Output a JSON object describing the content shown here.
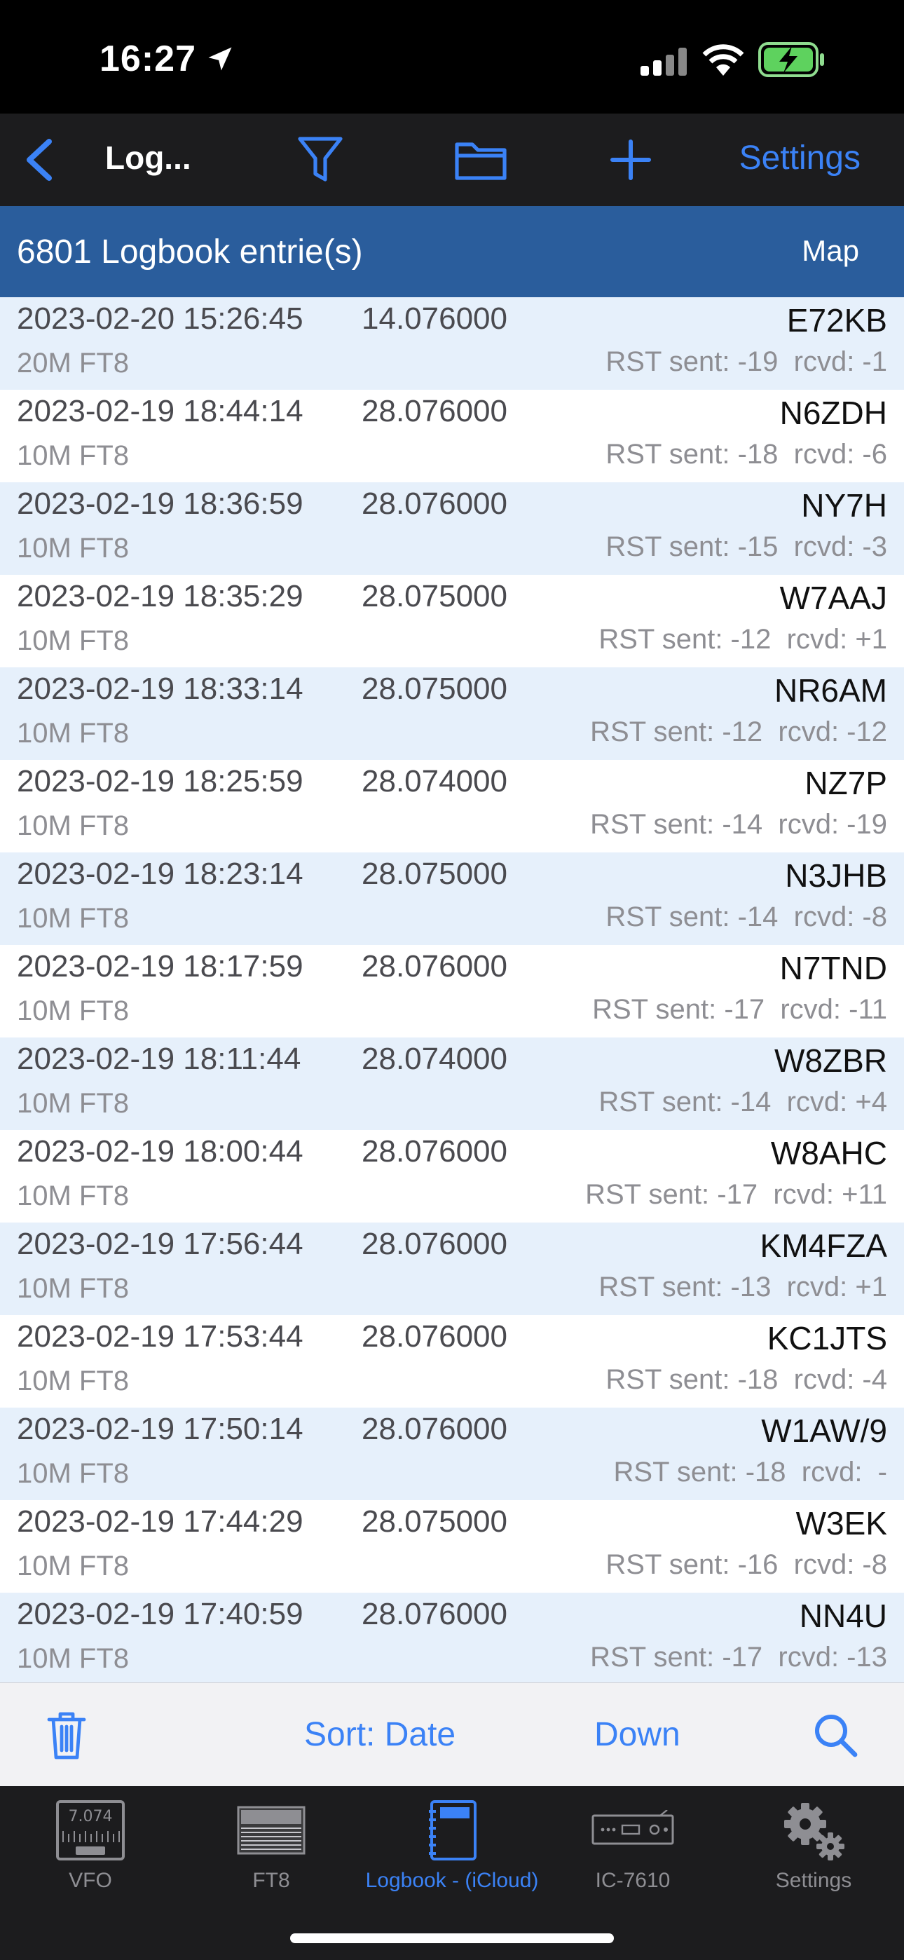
{
  "status_bar": {
    "time": "16:27"
  },
  "nav": {
    "title": "Log...",
    "settings_label": "Settings"
  },
  "header": {
    "count_label": "6801 Logbook entrie(s)",
    "map_label": "Map"
  },
  "entries": [
    {
      "date": "2023-02-20 15:26:45",
      "freq": "14.076000",
      "call": "E72KB",
      "mode": "20M FT8",
      "rst": "RST sent: -19  rcvd: -1"
    },
    {
      "date": "2023-02-19 18:44:14",
      "freq": "28.076000",
      "call": "N6ZDH",
      "mode": "10M FT8",
      "rst": "RST sent: -18  rcvd: -6"
    },
    {
      "date": "2023-02-19 18:36:59",
      "freq": "28.076000",
      "call": "NY7H",
      "mode": "10M FT8",
      "rst": "RST sent: -15  rcvd: -3"
    },
    {
      "date": "2023-02-19 18:35:29",
      "freq": "28.075000",
      "call": "W7AAJ",
      "mode": "10M FT8",
      "rst": "RST sent: -12  rcvd: +1"
    },
    {
      "date": "2023-02-19 18:33:14",
      "freq": "28.075000",
      "call": "NR6AM",
      "mode": "10M FT8",
      "rst": "RST sent: -12  rcvd: -12"
    },
    {
      "date": "2023-02-19 18:25:59",
      "freq": "28.074000",
      "call": "NZ7P",
      "mode": "10M FT8",
      "rst": "RST sent: -14  rcvd: -19"
    },
    {
      "date": "2023-02-19 18:23:14",
      "freq": "28.075000",
      "call": "N3JHB",
      "mode": "10M FT8",
      "rst": "RST sent: -14  rcvd: -8"
    },
    {
      "date": "2023-02-19 18:17:59",
      "freq": "28.076000",
      "call": "N7TND",
      "mode": "10M FT8",
      "rst": "RST sent: -17  rcvd: -11"
    },
    {
      "date": "2023-02-19 18:11:44",
      "freq": "28.074000",
      "call": "W8ZBR",
      "mode": "10M FT8",
      "rst": "RST sent: -14  rcvd: +4"
    },
    {
      "date": "2023-02-19 18:00:44",
      "freq": "28.076000",
      "call": "W8AHC",
      "mode": "10M FT8",
      "rst": "RST sent: -17  rcvd: +11"
    },
    {
      "date": "2023-02-19 17:56:44",
      "freq": "28.076000",
      "call": "KM4FZA",
      "mode": "10M FT8",
      "rst": "RST sent: -13  rcvd: +1"
    },
    {
      "date": "2023-02-19 17:53:44",
      "freq": "28.076000",
      "call": "KC1JTS",
      "mode": "10M FT8",
      "rst": "RST sent: -18  rcvd: -4"
    },
    {
      "date": "2023-02-19 17:50:14",
      "freq": "28.076000",
      "call": "W1AW/9",
      "mode": "10M FT8",
      "rst": "RST sent: -18  rcvd:  -"
    },
    {
      "date": "2023-02-19 17:44:29",
      "freq": "28.075000",
      "call": "W3EK",
      "mode": "10M FT8",
      "rst": "RST sent: -16  rcvd: -8"
    },
    {
      "date": "2023-02-19 17:40:59",
      "freq": "28.076000",
      "call": "NN4U",
      "mode": "10M FT8",
      "rst": "RST sent: -17  rcvd: -13"
    }
  ],
  "toolbar": {
    "sort_label": "Sort: Date",
    "direction_label": "Down"
  },
  "tabs": [
    {
      "label": "VFO",
      "icon": "vfo-display-icon",
      "icon_text": "7.074",
      "active": false
    },
    {
      "label": "FT8",
      "icon": "waterfall-icon",
      "active": false
    },
    {
      "label": "Logbook - (iCloud)",
      "icon": "logbook-icon",
      "active": true
    },
    {
      "label": "IC-7610",
      "icon": "radio-icon",
      "active": false
    },
    {
      "label": "Settings",
      "icon": "gears-icon",
      "active": false
    }
  ],
  "colors": {
    "accent": "#3b82f6",
    "header": "#2a5d9c",
    "row_alt": "#e6f0fb"
  }
}
